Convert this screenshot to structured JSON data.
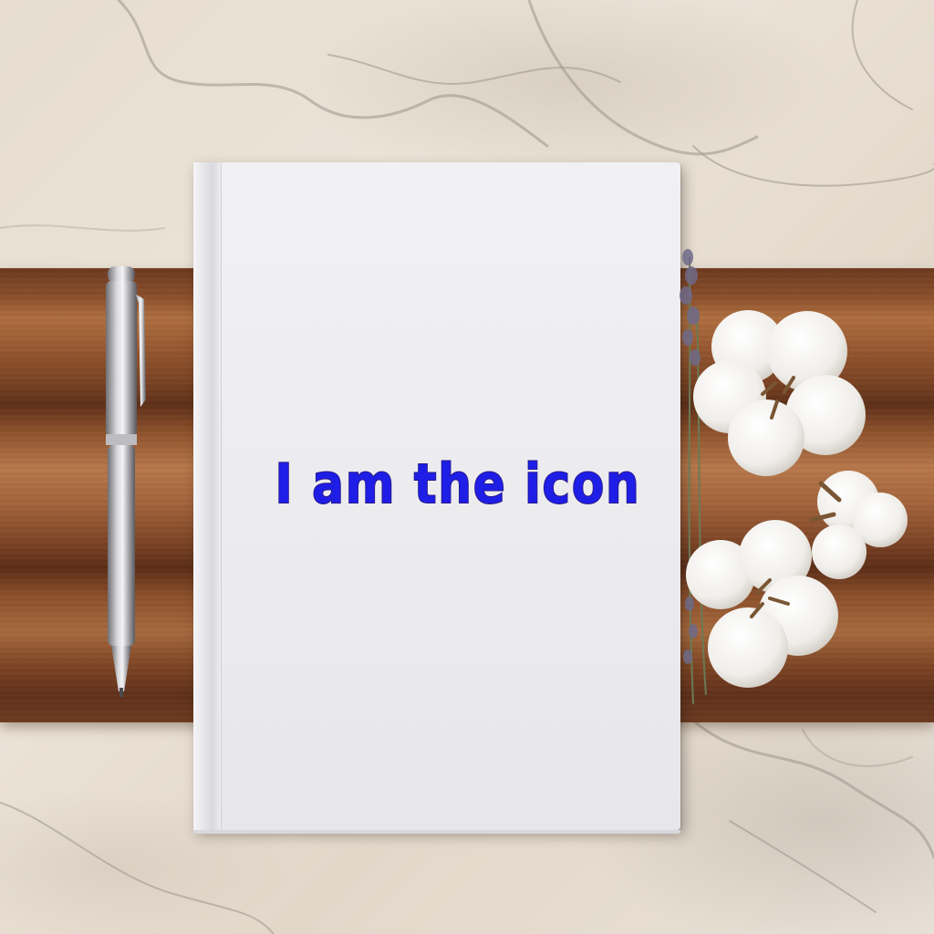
{
  "overlay": {
    "text": "I am the icon",
    "color": "#1e1ee6"
  },
  "scene": {
    "objects": [
      "marble-icon",
      "wood-board-icon",
      "notebook-icon",
      "pen-icon",
      "lavender-icon",
      "cotton-icon"
    ]
  }
}
